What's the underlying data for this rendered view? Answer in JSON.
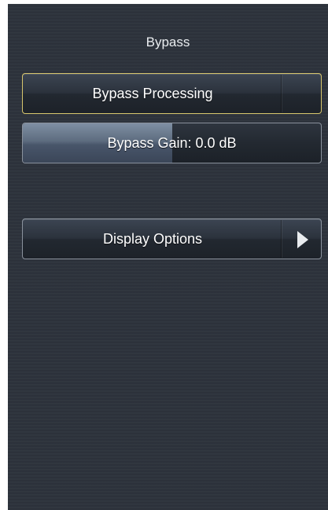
{
  "panel": {
    "title": "Bypass"
  },
  "controls": {
    "bypass_processing": {
      "label": "Bypass Processing",
      "active": true
    },
    "bypass_gain": {
      "label": "Bypass Gain: 0.0 dB",
      "fill_fraction": 0.5
    },
    "display_options": {
      "label": "Display Options",
      "icon": "chevron-right-icon"
    }
  },
  "colors": {
    "panel_bg": "#2d333c",
    "active_border": "#d6c56c",
    "gain_fill": "#6a798c"
  }
}
